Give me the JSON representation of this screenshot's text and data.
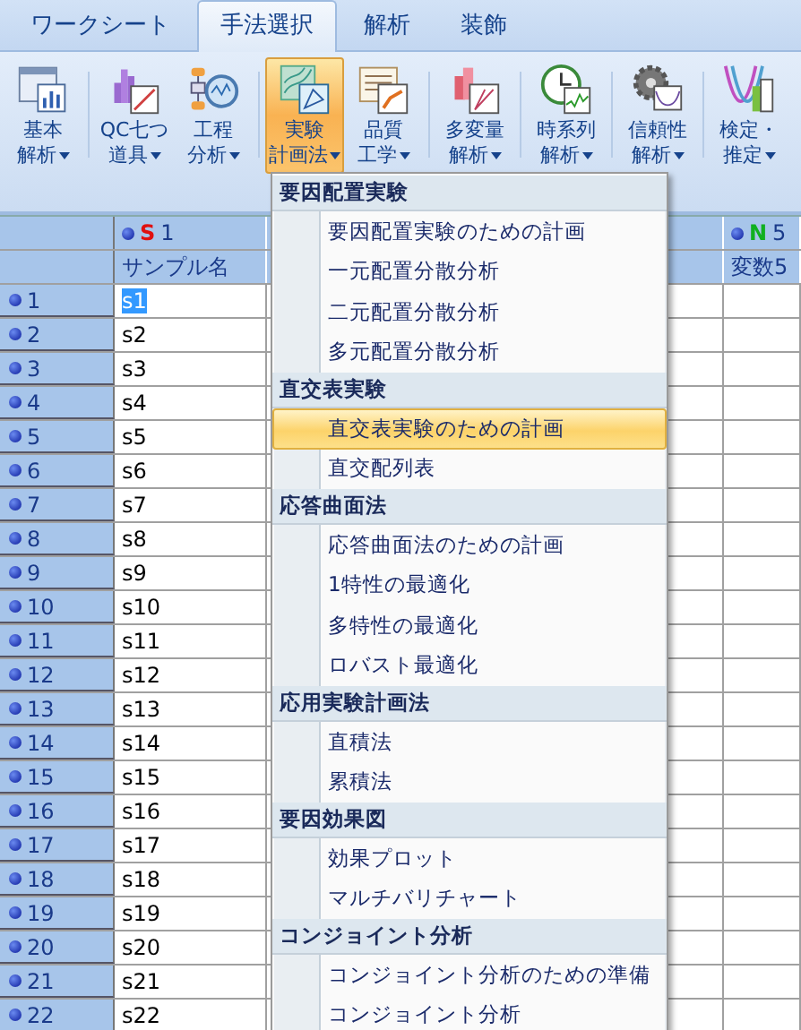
{
  "tabs": [
    {
      "label": "ワークシート",
      "selected": false
    },
    {
      "label": "手法選択",
      "selected": true
    },
    {
      "label": "解析",
      "selected": false
    },
    {
      "label": "装飾",
      "selected": false
    }
  ],
  "ribbon": {
    "groups": [
      {
        "buttons": [
          {
            "line1": "基本",
            "line2": "解析",
            "selected": false
          }
        ]
      },
      {
        "buttons": [
          {
            "line1": "QC七つ",
            "line2": "道具",
            "selected": false
          },
          {
            "line1": "工程",
            "line2": "分析",
            "selected": false
          }
        ]
      },
      {
        "buttons": [
          {
            "line1": "実験",
            "line2": "計画法",
            "selected": true
          },
          {
            "line1": "品質",
            "line2": "工学",
            "selected": false
          }
        ]
      },
      {
        "buttons": [
          {
            "line1": "多変量",
            "line2": "解析",
            "selected": false
          }
        ]
      },
      {
        "buttons": [
          {
            "line1": "時系列",
            "line2": "解析",
            "selected": false
          }
        ]
      },
      {
        "buttons": [
          {
            "line1": "信頼性",
            "line2": "解析",
            "selected": false
          }
        ]
      },
      {
        "buttons": [
          {
            "line1": "検定・",
            "line2": "推定",
            "selected": false
          }
        ]
      }
    ]
  },
  "grid": {
    "columns": [
      {
        "kind": "string",
        "mark": "S",
        "number": "1",
        "name": "サンプル名"
      },
      {
        "kind": "covered"
      },
      {
        "kind": "covered"
      },
      {
        "kind": "blank"
      },
      {
        "kind": "numeric",
        "mark": "N",
        "number": "5",
        "name": "変数5"
      }
    ],
    "rows": [
      {
        "number": "1",
        "value": "s1",
        "selected": true
      },
      {
        "number": "2",
        "value": "s2",
        "selected": false
      },
      {
        "number": "3",
        "value": "s3",
        "selected": false
      },
      {
        "number": "4",
        "value": "s4",
        "selected": false
      },
      {
        "number": "5",
        "value": "s5",
        "selected": false
      },
      {
        "number": "6",
        "value": "s6",
        "selected": false
      },
      {
        "number": "7",
        "value": "s7",
        "selected": false
      },
      {
        "number": "8",
        "value": "s8",
        "selected": false
      },
      {
        "number": "9",
        "value": "s9",
        "selected": false
      },
      {
        "number": "10",
        "value": "s10",
        "selected": false
      },
      {
        "number": "11",
        "value": "s11",
        "selected": false
      },
      {
        "number": "12",
        "value": "s12",
        "selected": false
      },
      {
        "number": "13",
        "value": "s13",
        "selected": false
      },
      {
        "number": "14",
        "value": "s14",
        "selected": false
      },
      {
        "number": "15",
        "value": "s15",
        "selected": false
      },
      {
        "number": "16",
        "value": "s16",
        "selected": false
      },
      {
        "number": "17",
        "value": "s17",
        "selected": false
      },
      {
        "number": "18",
        "value": "s18",
        "selected": false
      },
      {
        "number": "19",
        "value": "s19",
        "selected": false
      },
      {
        "number": "20",
        "value": "s20",
        "selected": false
      },
      {
        "number": "21",
        "value": "s21",
        "selected": false
      },
      {
        "number": "22",
        "value": "s22",
        "selected": false
      }
    ]
  },
  "menu": {
    "sections": [
      {
        "heading": "要因配置実験",
        "items": [
          {
            "label": "要因配置実験のための計画",
            "selected": false
          },
          {
            "label": "一元配置分散分析",
            "selected": false
          },
          {
            "label": "二元配置分散分析",
            "selected": false
          },
          {
            "label": "多元配置分散分析",
            "selected": false
          }
        ]
      },
      {
        "heading": "直交表実験",
        "items": [
          {
            "label": "直交表実験のための計画",
            "selected": true
          },
          {
            "label": "直交配列表",
            "selected": false
          }
        ]
      },
      {
        "heading": "応答曲面法",
        "items": [
          {
            "label": "応答曲面法のための計画",
            "selected": false
          },
          {
            "label": "1特性の最適化",
            "selected": false
          },
          {
            "label": "多特性の最適化",
            "selected": false
          },
          {
            "label": "ロバスト最適化",
            "selected": false
          }
        ]
      },
      {
        "heading": "応用実験計画法",
        "items": [
          {
            "label": "直積法",
            "selected": false
          },
          {
            "label": "累積法",
            "selected": false
          }
        ]
      },
      {
        "heading": "要因効果図",
        "items": [
          {
            "label": "効果プロット",
            "selected": false
          },
          {
            "label": "マルチバリチャート",
            "selected": false
          }
        ]
      },
      {
        "heading": "コンジョイント分析",
        "items": [
          {
            "label": "コンジョイント分析のための準備",
            "selected": false
          },
          {
            "label": "コンジョイント分析",
            "selected": false
          }
        ]
      }
    ]
  }
}
